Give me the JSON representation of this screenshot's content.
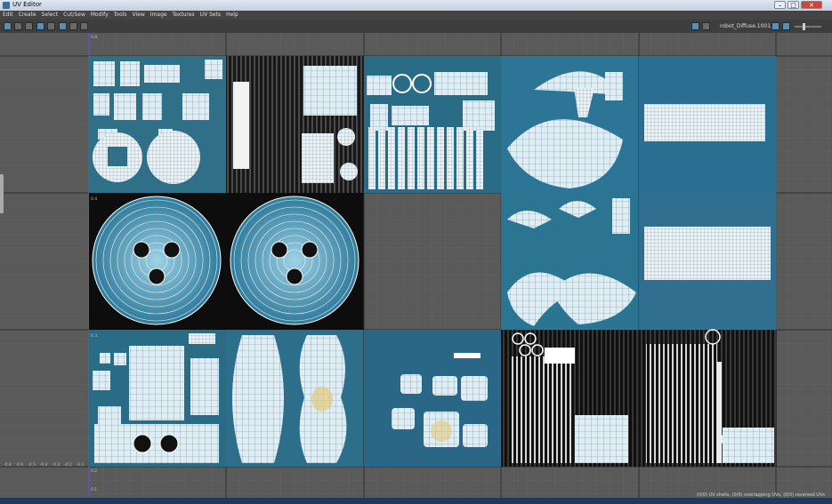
{
  "window": {
    "title": "UV Editor",
    "minimize": "–",
    "maximize": "□",
    "close": "✕"
  },
  "menu": [
    "Edit",
    "Create",
    "Select",
    "Cut/Sew",
    "Modify",
    "Tools",
    "View",
    "Image",
    "Textures",
    "UV Sets",
    "Help"
  ],
  "toolbar": {
    "left_icons": [
      "uv-select-icon",
      "uv-move-icon",
      "uv-layout-icon",
      "uv-grid-icon",
      "uv-display-icon",
      "uv-shaded-icon",
      "uv-filter-icon",
      "uv-snapshot-icon"
    ],
    "texture_name": "robot_Diffuse.1001.pr",
    "right_icons": [
      "image-display-icon",
      "checker-icon",
      "exposure-icon",
      "gamma-icon"
    ]
  },
  "grid": {
    "tick_labels_v": [
      "0.8",
      "0.4",
      "0.3",
      "0.2",
      "0.1"
    ],
    "tick_labels_h": [
      "-0.8",
      "-0.6",
      "-0.5",
      "-0.4",
      "-0.3",
      "-0.2",
      "-0.1"
    ]
  },
  "status": "(0/0) UV shells, (0/0) overlapping UVs, (0/0) reversed UVs",
  "colors": {
    "accent": "#5b8eb3",
    "wire": "#ffffff",
    "grid_bg": "#5a5a5a",
    "tile_blue": "#2a6f8c"
  }
}
